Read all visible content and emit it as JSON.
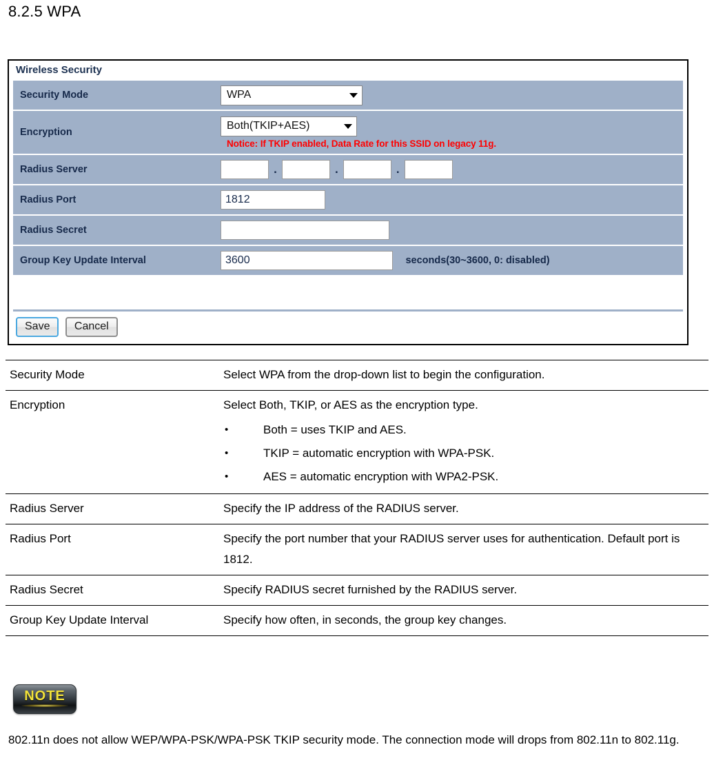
{
  "page": {
    "heading": "8.2.5 WPA"
  },
  "panel": {
    "title": "Wireless Security",
    "rows": {
      "security_mode": {
        "label": "Security Mode",
        "selected": "WPA"
      },
      "encryption": {
        "label": "Encryption",
        "selected": "Both(TKIP+AES)",
        "notice": "Notice: If TKIP enabled, Data Rate for this SSID on legacy 11g."
      },
      "radius_server": {
        "label": "Radius Server",
        "octets": [
          "",
          "",
          "",
          ""
        ],
        "separator": "."
      },
      "radius_port": {
        "label": "Radius Port",
        "value": "1812"
      },
      "radius_secret": {
        "label": "Radius Secret",
        "value": ""
      },
      "group_key_update_interval": {
        "label": "Group Key Update Interval",
        "value": "3600",
        "unit": "seconds(30~3600, 0: disabled)"
      }
    },
    "buttons": {
      "save": "Save",
      "cancel": "Cancel"
    },
    "colors": {
      "row_background": "#9fb0c8",
      "label_text": "#16294a",
      "notice_text": "#ff0000",
      "save_border": "#4aa8e0"
    }
  },
  "description_table": {
    "rows": [
      {
        "term": "Security Mode",
        "definition": "Select WPA from the drop-down  list to begin the configuration.",
        "bullets": []
      },
      {
        "term": "Encryption",
        "definition": "Select Both, TKIP, or AES as the encryption type.",
        "bullets": [
          "Both = uses TKIP and AES.",
          "TKIP = automatic encryption with WPA-PSK.",
          "AES = automatic encryption with WPA2-PSK."
        ]
      },
      {
        "term": "Radius Server",
        "definition": "Specify the IP address of the RADIUS server.",
        "bullets": []
      },
      {
        "term": "Radius Port",
        "definition": "Specify the port number that your RADIUS server uses for authentication. Default port is 1812.",
        "bullets": []
      },
      {
        "term": "Radius Secret",
        "definition": "Specify RADIUS secret furnished by the RADIUS server.",
        "bullets": []
      },
      {
        "term": "Group Key Update Interval",
        "definition": "Specify how often, in seconds, the group key changes.",
        "bullets": []
      }
    ]
  },
  "note": {
    "badge_label": "NOTE",
    "text": "802.11n does not allow WEP/WPA-PSK/WPA-PSK TKIP security mode. The connection mode will drops from 802.11n to 802.11g."
  }
}
